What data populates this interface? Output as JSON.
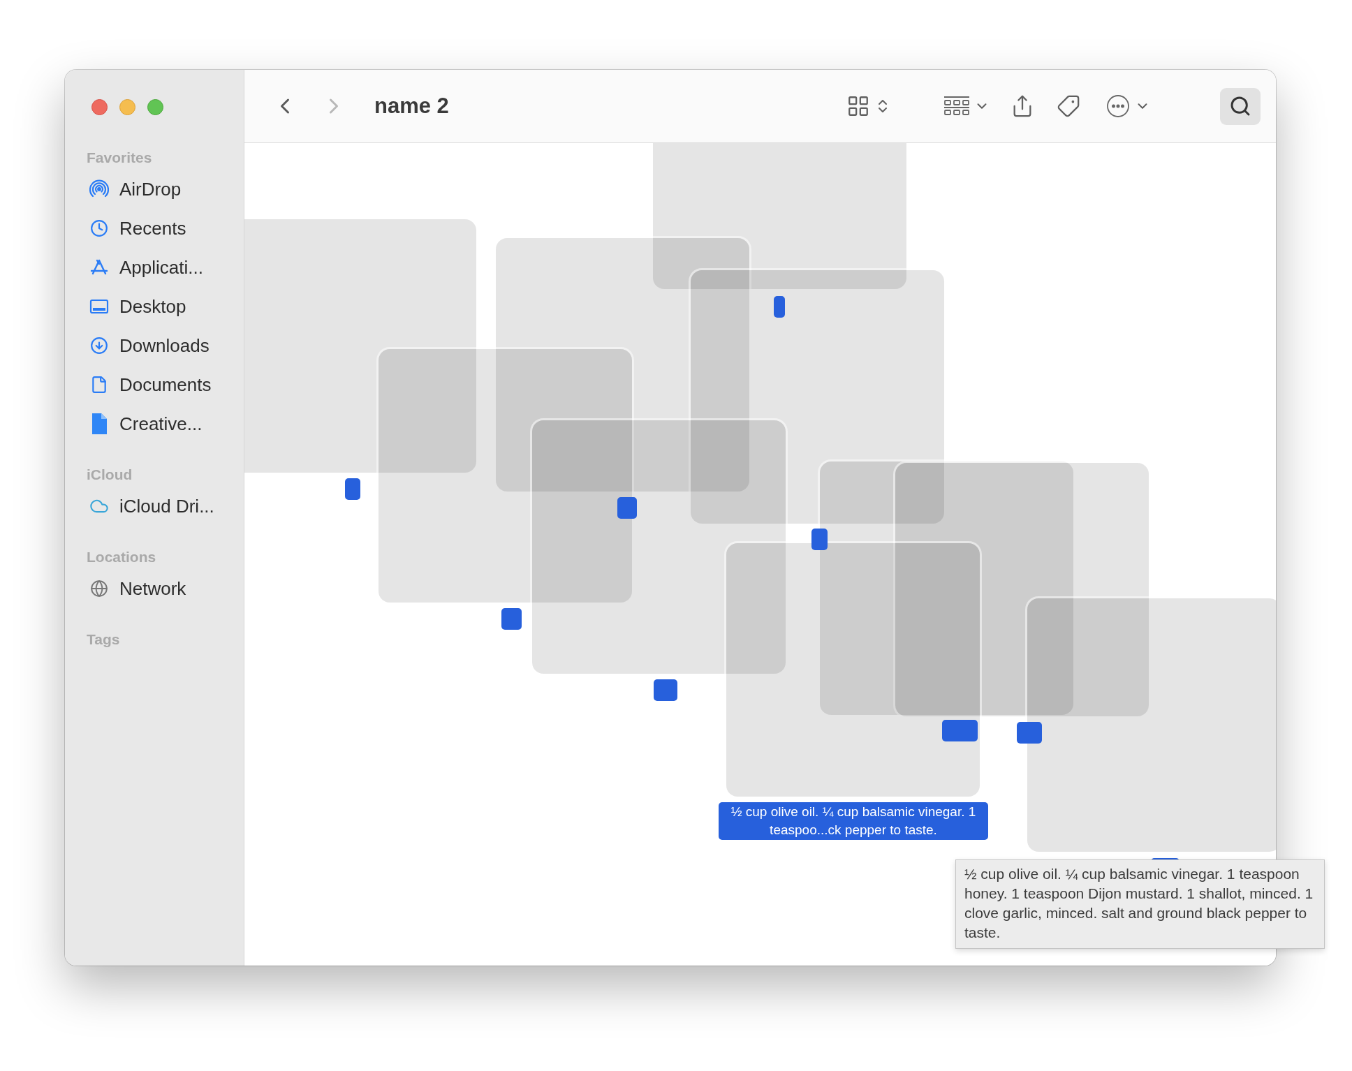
{
  "window": {
    "title": "name 2"
  },
  "toolbar": {
    "back": {
      "disabled": false
    },
    "forward": {
      "disabled": true
    }
  },
  "sidebar": {
    "sections": [
      {
        "header": "Favorites",
        "items": [
          {
            "label": "AirDrop",
            "kind": "airdrop"
          },
          {
            "label": "Recents",
            "kind": "recents"
          },
          {
            "label": "Applicati...",
            "kind": "applications"
          },
          {
            "label": "Desktop",
            "kind": "desktop"
          },
          {
            "label": "Downloads",
            "kind": "downloads"
          },
          {
            "label": "Documents",
            "kind": "documents"
          },
          {
            "label": "Creative...",
            "kind": "file"
          }
        ]
      },
      {
        "header": "iCloud",
        "items": [
          {
            "label": "iCloud Dri...",
            "kind": "cloud"
          }
        ]
      },
      {
        "header": "Locations",
        "items": [
          {
            "label": "Network",
            "kind": "network"
          }
        ]
      },
      {
        "header": "Tags"
      }
    ]
  },
  "files": [
    {
      "selected": true
    },
    {
      "selected": true
    },
    {
      "selected": true
    },
    {
      "selected": true
    },
    {
      "selected": true
    },
    {
      "selected": true
    },
    {
      "selected": true
    },
    {
      "selected": true
    },
    {
      "selected": true,
      "label": "½ cup olive oil. ¼ cup balsamic vinegar. 1 teaspoo...ck pepper to taste."
    },
    {
      "selected": true
    }
  ],
  "tooltip": {
    "text": "½ cup olive oil. ¼ cup balsamic vinegar. 1 teaspoon honey. 1 teaspoon Dijon mustard. 1 shallot, minced. 1 clove garlic, minced. salt and ground black pepper to taste."
  }
}
